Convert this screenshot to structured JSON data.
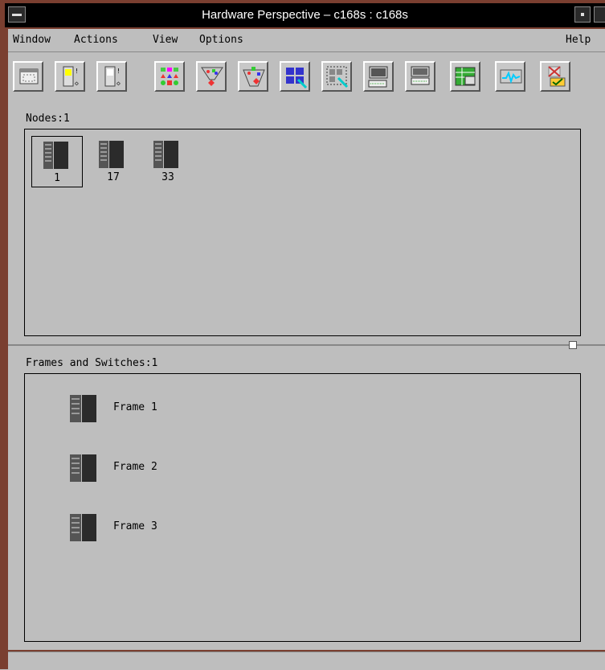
{
  "window": {
    "title": "Hardware Perspective – c168s : c168s"
  },
  "menubar": {
    "items": [
      {
        "label": "Window"
      },
      {
        "label": "Actions"
      },
      {
        "label": "View"
      },
      {
        "label": "Options"
      }
    ],
    "help": "Help"
  },
  "toolbar": {
    "buttons": [
      {
        "icon": "window-icon"
      },
      {
        "icon": "node-yellow-icon"
      },
      {
        "icon": "node-white-icon"
      },
      {
        "icon": "shapes-grid-icon"
      },
      {
        "icon": "filter-funnel-icon"
      },
      {
        "icon": "filter-funnel-alt-icon"
      },
      {
        "icon": "select-all-icon"
      },
      {
        "icon": "deselect-icon"
      },
      {
        "icon": "keyboard-console-icon"
      },
      {
        "icon": "keyboard-console-alt-icon"
      },
      {
        "icon": "table-edit-icon"
      },
      {
        "icon": "monitor-graph-icon"
      },
      {
        "icon": "cancel-check-icon"
      }
    ]
  },
  "nodes_panel": {
    "title": "Nodes:1",
    "nodes": [
      {
        "label": "1",
        "selected": true
      },
      {
        "label": "17",
        "selected": false
      },
      {
        "label": "33",
        "selected": false
      }
    ]
  },
  "frames_panel": {
    "title": "Frames and Switches:1",
    "frames": [
      {
        "label": "Frame 1"
      },
      {
        "label": "Frame 2"
      },
      {
        "label": "Frame 3"
      }
    ]
  },
  "colors": {
    "title_bg": "#000000",
    "client_bg": "#bebebe",
    "border_accent": "#7a3f30"
  }
}
